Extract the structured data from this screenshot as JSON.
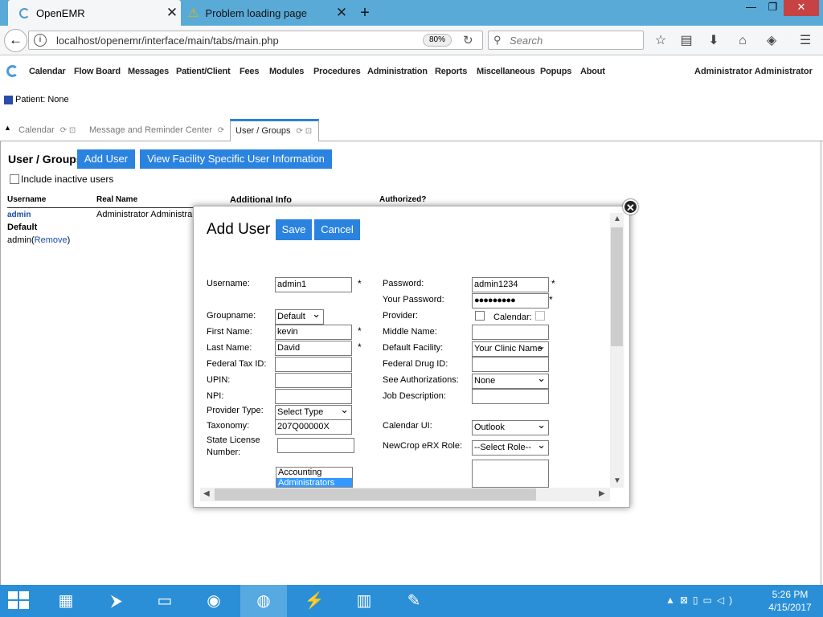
{
  "browser": {
    "tabs": [
      {
        "title": "OpenEMR"
      },
      {
        "title": "Problem loading page"
      }
    ],
    "url": "localhost/openemr/interface/main/tabs/main.php",
    "zoom": "80%",
    "search_placeholder": "Search"
  },
  "app_menu": {
    "items": [
      "Calendar",
      "Flow Board",
      "Messages",
      "Patient/Client",
      "Fees",
      "Modules",
      "Procedures",
      "Administration",
      "Reports",
      "Miscellaneous",
      "Popups",
      "About"
    ],
    "user": "Administrator Administrator"
  },
  "patient_label": "Patient: None",
  "app_tabs": [
    "Calendar",
    "Message and Reminder Center",
    "User / Groups"
  ],
  "page": {
    "title": "User / Groups",
    "add_user": "Add User",
    "view_facility": "View Facility Specific User Information",
    "include_inactive": "Include inactive users",
    "columns": [
      "Username",
      "Real Name",
      "Additional Info",
      "Authorized?"
    ],
    "row_username": "admin",
    "row_realname": "Administrator Administra",
    "group_name": "Default",
    "group_member": "admin",
    "remove_label": "Remove"
  },
  "modal": {
    "title": "Add User",
    "save": "Save",
    "cancel": "Cancel",
    "labels": {
      "username": "Username:",
      "password": "Password:",
      "your_password": "Your Password:",
      "groupname": "Groupname:",
      "provider": "Provider:",
      "calendar": "Calendar:",
      "first_name": "First Name:",
      "middle_name": "Middle Name:",
      "last_name": "Last Name:",
      "default_facility": "Default Facility:",
      "federal_tax_id": "Federal Tax ID:",
      "federal_drug_id": "Federal Drug ID:",
      "upin": "UPIN:",
      "see_authorizations": "See Authorizations:",
      "npi": "NPI:",
      "job_description": "Job Description:",
      "provider_type": "Provider Type:",
      "taxonomy": "Taxonomy:",
      "calendar_ui": "Calendar UI:",
      "state_license_1": "State License",
      "state_license_2": "Number:",
      "newcrop_role": "NewCrop eRX Role:"
    },
    "values": {
      "username": "admin1",
      "password": "admin1234",
      "your_password": "●●●●●●●●●",
      "groupname": "Default",
      "first_name": "kevin",
      "last_name": "David",
      "default_facility": "Your Clinic Name",
      "see_authorizations": "None",
      "provider_type": "Select Type",
      "taxonomy": "207Q00000X",
      "calendar_ui": "Outlook",
      "newcrop_role": "--Select Role--"
    },
    "access_control_options": [
      "Accounting",
      "Administrators"
    ]
  },
  "taskbar": {
    "time": "5:26 PM",
    "date": "4/15/2017"
  }
}
